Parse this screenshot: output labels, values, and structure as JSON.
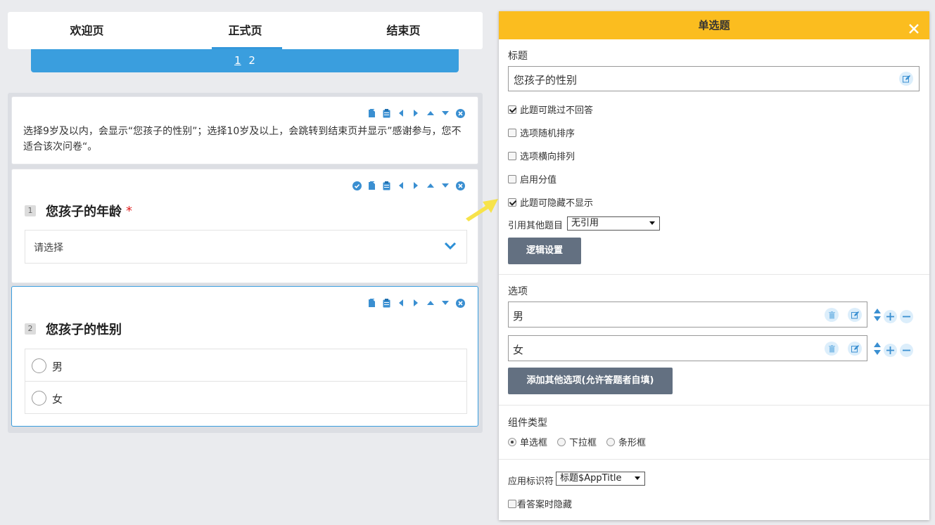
{
  "tabs": [
    {
      "label": "欢迎页"
    },
    {
      "label": "正式页"
    },
    {
      "label": "结束页"
    }
  ],
  "active_tab": 1,
  "pager": {
    "pages": [
      "1",
      "2"
    ],
    "current": "1"
  },
  "note": {
    "text": "选择9岁及以内，会显示“您孩子的性别”；选择10岁及以上，会跳转到结束页并显示”感谢参与，您不适合该次问卷“。"
  },
  "question1": {
    "number": "1",
    "title": "您孩子的年龄",
    "required_mark": "*",
    "placeholder": "请选择"
  },
  "question2": {
    "number": "2",
    "title": "您孩子的性别",
    "options": [
      "男",
      "女"
    ]
  },
  "panel": {
    "header": "单选题",
    "title_label": "标题",
    "title_value": "您孩子的性别",
    "checkboxes": [
      {
        "label": "此题可跳过不回答",
        "checked": true
      },
      {
        "label": "选项随机排序",
        "checked": false
      },
      {
        "label": "选项横向排列",
        "checked": false
      },
      {
        "label": "启用分值",
        "checked": false
      },
      {
        "label": "此题可隐藏不显示",
        "checked": true
      }
    ],
    "ref_label": "引用其他题目",
    "ref_value": "无引用",
    "logic_button": "逻辑设置",
    "options_label": "选项",
    "options": [
      "男",
      "女"
    ],
    "add_other_button": "添加其他选项(允许答题者自填)",
    "component_label": "组件类型",
    "component_types": [
      {
        "label": "单选框",
        "selected": true
      },
      {
        "label": "下拉框",
        "selected": false
      },
      {
        "label": "条形框",
        "selected": false
      }
    ],
    "app_id_label": "应用标识符",
    "app_id_value": "标题$AppTitle",
    "hide_on_answer": {
      "label": "看答案时隐藏",
      "checked": false
    }
  },
  "colors": {
    "accent_blue": "#3a9ede",
    "panel_header": "#fbbd1f",
    "button_gray": "#637081",
    "required_red": "#e02020"
  }
}
